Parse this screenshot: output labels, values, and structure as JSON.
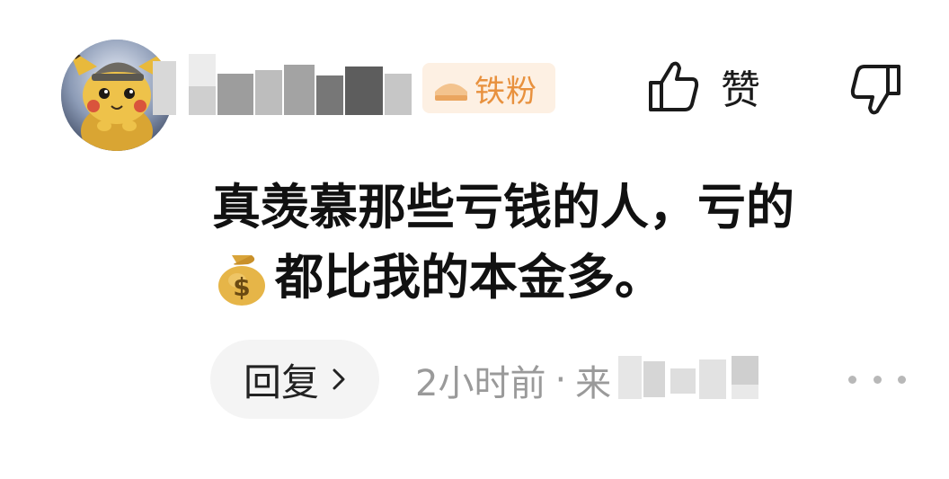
{
  "comment": {
    "username": "",
    "badge": {
      "icon": "fan-crown-icon",
      "label": "铁粉",
      "color": "#e8913e",
      "background": "#fdf0e3"
    },
    "like": {
      "icon": "thumb-up-icon",
      "label": "赞"
    },
    "dislike": {
      "icon": "thumb-down-icon"
    },
    "text_line1": "真羡慕那些亏钱的人，亏的",
    "text_emoji": "money-bag-icon",
    "text_line2": "都比我的本金多。",
    "reply": {
      "label": "回复",
      "icon": "chevron-right-icon"
    },
    "time": "2小时前",
    "separator": "·",
    "location_prefix": "来",
    "more": {
      "icon": "more-dots-icon"
    }
  }
}
